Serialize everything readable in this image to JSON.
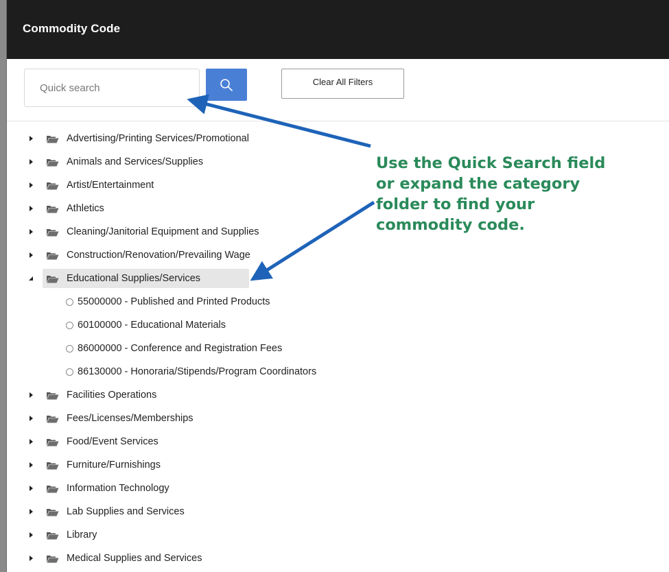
{
  "window": {
    "title": "Commodity Code"
  },
  "search": {
    "placeholder": "Quick search",
    "clear_label": "Clear All Filters"
  },
  "tree": {
    "items_before": [
      {
        "label": "Advertising/Printing Services/Promotional",
        "expanded": false
      },
      {
        "label": "Animals and Services/Supplies",
        "expanded": false
      },
      {
        "label": "Artist/Entertainment",
        "expanded": false
      },
      {
        "label": "Athletics",
        "expanded": false
      },
      {
        "label": "Cleaning/Janitorial Equipment and Supplies",
        "expanded": false
      },
      {
        "label": "Construction/Renovation/Prevailing Wage",
        "expanded": false
      }
    ],
    "expanded_item": {
      "label": "Educational Supplies/Services",
      "expanded": true,
      "children": [
        "55000000 - Published and Printed Products",
        "60100000 - Educational Materials",
        "86000000 - Conference and Registration Fees",
        "86130000 - Honoraria/Stipends/Program Coordinators"
      ]
    },
    "items_after": [
      {
        "label": "Facilities Operations",
        "expanded": false
      },
      {
        "label": "Fees/Licenses/Memberships",
        "expanded": false
      },
      {
        "label": "Food/Event Services",
        "expanded": false
      },
      {
        "label": "Furniture/Furnishings",
        "expanded": false
      },
      {
        "label": "Information Technology",
        "expanded": false
      },
      {
        "label": "Lab Supplies and Services",
        "expanded": false
      },
      {
        "label": "Library",
        "expanded": false
      },
      {
        "label": "Medical Supplies and Services",
        "expanded": false
      }
    ]
  },
  "annotation": {
    "lines": [
      "Use the Quick Search field",
      "or expand the category",
      "folder to find your",
      "commodity code."
    ],
    "color": "#2a8a5a",
    "arrow_color": "#1e63b8"
  },
  "icons": {
    "search": "search-icon",
    "folder": "folder-open-icon",
    "caret_right": "caret-right-icon",
    "caret_down": "caret-down-icon",
    "radio": "radio-icon"
  }
}
